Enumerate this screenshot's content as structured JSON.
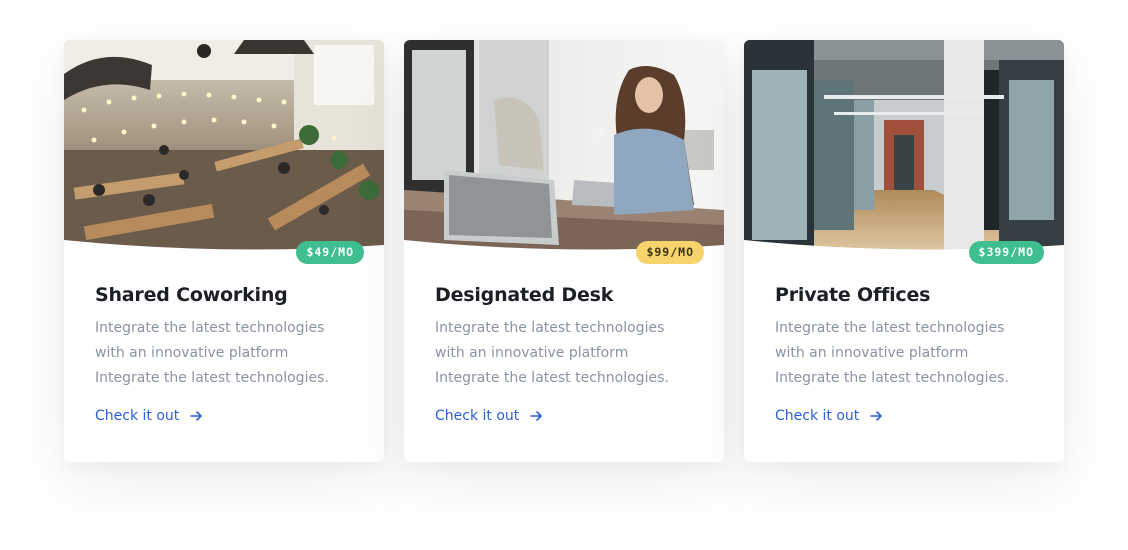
{
  "cards": [
    {
      "title": "Shared Coworking",
      "price": "$49/MO",
      "price_color": "#3fbf8f",
      "photo": "coworking-photo",
      "description": [
        "Integrate the latest technologies",
        "with an innovative platform",
        "Integrate the latest technologies."
      ],
      "link_label": "Check it out",
      "link_icon": "arrow-right-icon"
    },
    {
      "title": "Designated Desk",
      "price": "$99/MO",
      "price_color": "#f7d46b",
      "photo": "desk-photo",
      "description": [
        "Integrate the latest technologies",
        "with an innovative platform",
        "Integrate the latest technologies."
      ],
      "link_label": "Check it out",
      "link_icon": "arrow-right-icon"
    },
    {
      "title": "Private Offices",
      "price": "$399/MO",
      "price_color": "#3fbf8f",
      "photo": "office-corridor-photo",
      "description": [
        "Integrate the latest technologies",
        "with an innovative platform",
        "Integrate the latest technologies."
      ],
      "link_label": "Check it out",
      "link_icon": "arrow-right-icon"
    }
  ],
  "colors": {
    "link": "#2b5fd9",
    "title": "#1c1f26",
    "body_text": "#8b93a3",
    "badge_green": "#3fbf8f",
    "badge_yellow": "#f7d46b"
  }
}
